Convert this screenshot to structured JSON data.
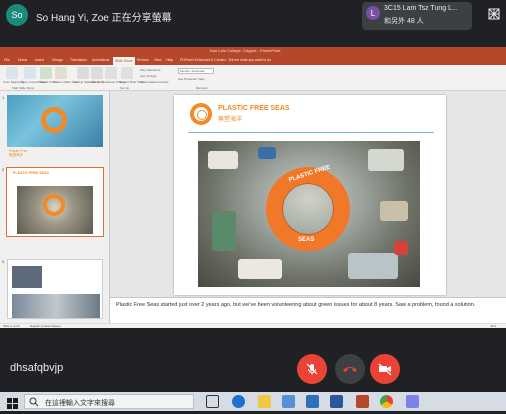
{
  "meet": {
    "presenter_initials": "So",
    "presenter_text": "So Hang Yi, Zoe 正在分享螢幕",
    "participant_initial": "L",
    "participant_name": "3C15 Lam Tsz Tung L...",
    "participant_count": "和另外 48 人",
    "meeting_code": "dhsafqbvjp"
  },
  "ppt": {
    "window_title": "Kau Lam Collage, Claypot - PowerPoint",
    "tabs": [
      "File",
      "Home",
      "Insert",
      "Design",
      "Transitions",
      "Animations",
      "Slide Show",
      "Review",
      "View",
      "Help",
      "PDFsam Enhanced 6 Creator",
      "Tell me what you want to do"
    ],
    "active_tab": "Slide Show",
    "ribbon": {
      "from_beginning": "From Beginning",
      "from_current": "From Current Slide",
      "present_online": "Present Online",
      "custom_show": "Custom Slide Show",
      "setup": "Set Up Slide Show",
      "hide": "Hide Slide",
      "rehearse": "Rehearse Timings",
      "record": "Record Slide Show",
      "play_narrations": "Play Narrations",
      "use_timings": "Use Timings",
      "show_media": "Show Media Controls",
      "group_start": "Start Slide Show",
      "group_setup": "Set Up",
      "group_monitors": "Monitors",
      "monitor_value": "Monitor: Automatic",
      "presenter_view": "Use Presenter View"
    },
    "thumbs": [
      {
        "num": "1",
        "caption_en": "Plastic Free",
        "caption_zh": "無塑海洋"
      },
      {
        "num": "2",
        "brand": "PLASTIC FREE SEAS"
      },
      {
        "num": "3"
      }
    ],
    "slide": {
      "brand_en": "PLASTIC FREE SEAS",
      "brand_zh": "無塑海洋",
      "buoy_top": "PLASTIC FREE",
      "buoy_bottom": "SEAS"
    },
    "notes": "Plastic Free Seas started just over 2 years ago, but we've been volunteering about green issues for about 8 years. Saw a problem, found a solution.",
    "status_left": "Slide 2 of 23",
    "status_lang": "English (United States)",
    "status_zoom": "41%"
  },
  "taskbar": {
    "search_placeholder": "在這裡輸入文字來搜尋"
  },
  "colors": {
    "brand_orange": "#f28a2a",
    "ppt_red": "#b7472a",
    "meet_red": "#ea4335",
    "meet_bg": "#202124"
  }
}
